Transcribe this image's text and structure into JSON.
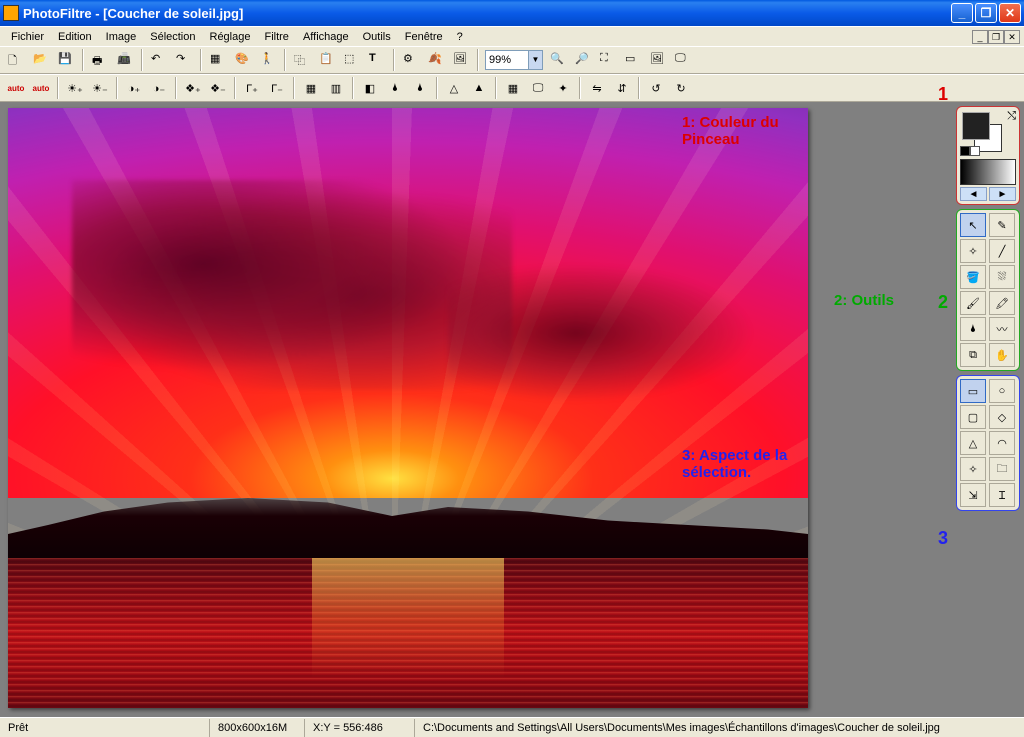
{
  "titlebar": {
    "text": "PhotoFiltre - [Coucher de soleil.jpg]"
  },
  "menu": {
    "items": [
      "Fichier",
      "Edition",
      "Image",
      "Sélection",
      "Réglage",
      "Filtre",
      "Affichage",
      "Outils",
      "Fenêtre",
      "?"
    ]
  },
  "toolbar1": {
    "zoom_value": "99%"
  },
  "annotations": {
    "a1_num": "1",
    "a1_text": "1: Couleur du Pinceau",
    "a2_num": "2",
    "a2_text": "2: Outils",
    "a3_num": "3",
    "a3_text": "3: Aspect de la sélection."
  },
  "palette": {
    "nav_left": "◄",
    "nav_right": "►"
  },
  "tools": {
    "items": [
      "pointer-icon",
      "eyedropper-icon",
      "wand-icon",
      "line-icon",
      "fill-icon",
      "spray-icon",
      "brush-icon",
      "brush2-icon",
      "blur-icon",
      "smudge-icon",
      "stamp-icon",
      "hand-icon"
    ],
    "selected": 0
  },
  "shapes": {
    "items": [
      "rect-icon",
      "circle-icon",
      "roundrect-icon",
      "diamond-icon",
      "triangle-icon",
      "arc-icon",
      "star-icon",
      "folder-icon",
      "size-icon",
      "ibeam-icon"
    ],
    "selected": 0
  },
  "statusbar": {
    "state": "Prêt",
    "dims": "800x600x16M",
    "coords": "X:Y = 556:486",
    "path": "C:\\Documents and Settings\\All Users\\Documents\\Mes images\\Échantillons d'images\\Coucher de soleil.jpg"
  },
  "icons": {
    "new": "🗋",
    "open": "📂",
    "save": "💾",
    "print": "🖶",
    "scan": "📠",
    "undo": "↶",
    "redo": "↷",
    "rgb": "▦",
    "palette": "🎨",
    "person": "🚶",
    "copy": "⿻",
    "paste": "📋",
    "sel": "⬚",
    "text": "T",
    "module": "⚙",
    "leaf": "🍂",
    "frame": "🖼",
    "zoomin": "🔍+",
    "zoomout": "🔍−",
    "zoom1": "🔍",
    "fit": "⛶",
    "full": "⛶",
    "screen": "🖵",
    "auto": "auto",
    "auto2": "auto",
    "lum1": "☀+",
    "lum2": "☀−",
    "sat1": "◐+",
    "sat2": "◐−",
    "gam1": "Γ+",
    "gam2": "Γ−",
    "gam3": "Γ",
    "gam4": "Γ",
    "grid1": "▦",
    "grid2": "▥",
    "drop1": "🌢",
    "drop2": "🌢",
    "tri1": "△",
    "tri2": "△",
    "rgb2": "▦",
    "mon": "🖵",
    "star": "✦",
    "flip1": "⇋",
    "flip2": "⇵",
    "rot1": "↺",
    "rot2": "↻"
  }
}
